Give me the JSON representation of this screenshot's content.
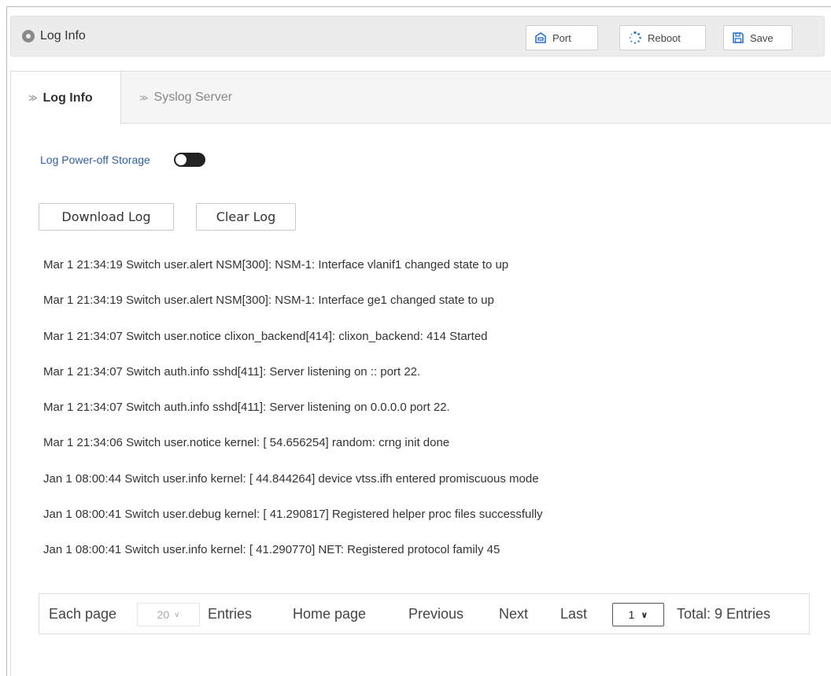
{
  "header": {
    "title": "Log Info",
    "buttons": {
      "port": "Port",
      "reboot": "Reboot",
      "save": "Save"
    }
  },
  "tabs": [
    {
      "label": "Log Info",
      "active": true
    },
    {
      "label": "Syslog Server",
      "active": false
    }
  ],
  "storage": {
    "label": "Log Power-off Storage",
    "enabled": false
  },
  "actions": {
    "download": "Download Log",
    "clear": "Clear Log"
  },
  "logs": [
    "Mar 1 21:34:19 Switch user.alert NSM[300]: NSM-1: Interface vlanif1 changed state to up",
    "Mar 1 21:34:19 Switch user.alert NSM[300]: NSM-1: Interface ge1 changed state to up",
    "Mar 1 21:34:07 Switch user.notice clixon_backend[414]: clixon_backend: 414 Started",
    "Mar 1 21:34:07 Switch auth.info sshd[411]: Server listening on :: port 22.",
    "Mar 1 21:34:07 Switch auth.info sshd[411]: Server listening on 0.0.0.0 port 22.",
    "Mar 1 21:34:06 Switch user.notice kernel: [ 54.656254] random: crng init done",
    "Jan 1 08:00:44 Switch user.info kernel: [ 44.844264] device vtss.ifh entered promiscuous mode",
    "Jan 1 08:00:41 Switch user.debug kernel: [ 41.290817] Registered helper proc files successfully",
    "Jan 1 08:00:41 Switch user.info kernel: [ 41.290770] NET: Registered protocol family 45"
  ],
  "pager": {
    "each_page": "Each page",
    "per_page_value": "20",
    "entries": "Entries",
    "home": "Home page",
    "previous": "Previous",
    "next": "Next",
    "last": "Last",
    "page_value": "1",
    "total": "Total: 9 Entries"
  }
}
